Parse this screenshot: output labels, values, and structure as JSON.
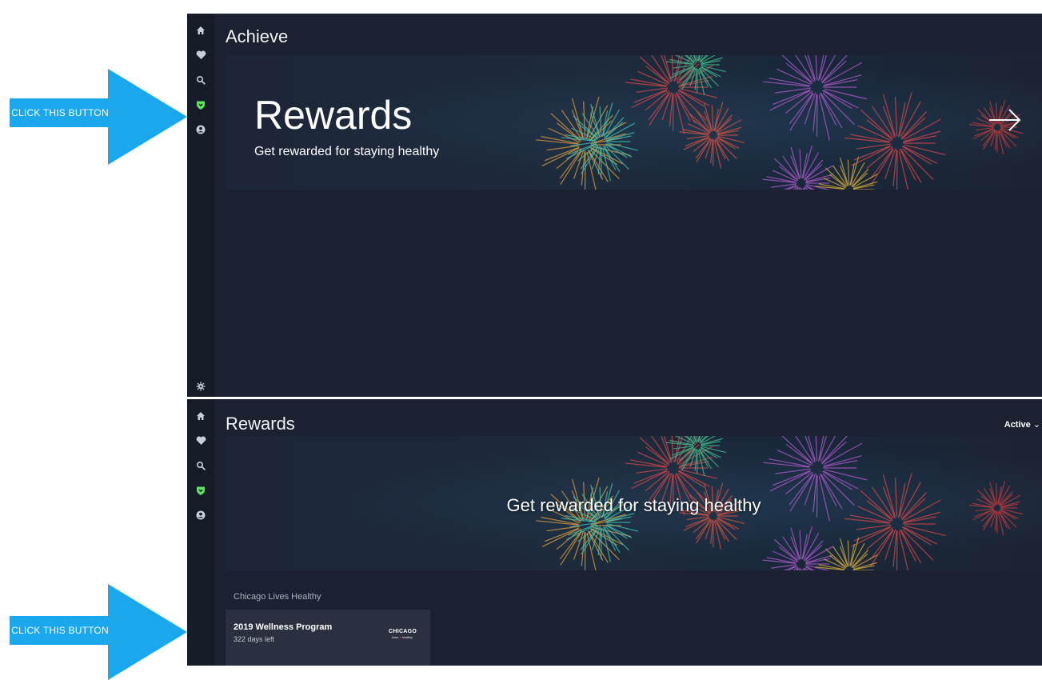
{
  "annotations": {
    "callout_1": "CLICK THIS BUTTON",
    "callout_2": "CLICK THIS BUTTON",
    "arrow_color": "#1aa7ec"
  },
  "nav": {
    "items": [
      "home-icon",
      "heart-icon",
      "search-icon",
      "shield-icon",
      "profile-icon"
    ],
    "settings": "gear-icon",
    "active_color": "#5ce65c",
    "icon_color": "#c9ced8"
  },
  "achieve_screen": {
    "title": "Achieve",
    "banner": {
      "title": "Rewards",
      "subtitle": "Get rewarded for staying healthy",
      "arrow_icon": "arrow-right-icon"
    }
  },
  "rewards_screen": {
    "title": "Rewards",
    "filter": "Active",
    "filter_icon": "chevron-down-icon",
    "banner_text": "Get rewarded for staying healthy",
    "section_label": "Chicago Lives Healthy",
    "program": {
      "title": "2019 Wellness Program",
      "days_left": "322 days left",
      "logo_line1": "CHICAGO",
      "logo_line2": "lives",
      "logo_line3": "healthy"
    }
  },
  "colors": {
    "background": "#1b2131",
    "sidebar": "#151b27",
    "card": "#2a3040"
  }
}
